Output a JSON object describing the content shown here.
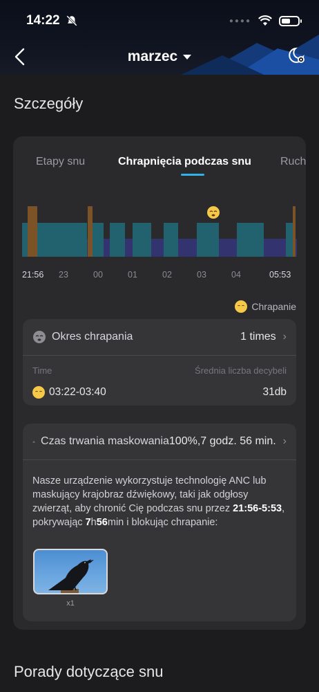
{
  "status": {
    "time": "14:22"
  },
  "nav": {
    "title": "marzec"
  },
  "sections": {
    "details": "Szczegóły",
    "tips": "Porady dotyczące snu"
  },
  "tabs": [
    {
      "label": "Etapy snu",
      "active": false
    },
    {
      "label": "Chrapnięcia podczas snu",
      "active": true
    },
    {
      "label": "Ruch",
      "active": false
    }
  ],
  "chart_data": {
    "type": "timeline",
    "x_tick_labels": [
      "21:56",
      "23",
      "00",
      "01",
      "02",
      "03",
      "04",
      "05:53"
    ],
    "legend": "Chrapanie",
    "colors": {
      "light": "#22616e",
      "deep": "#33336f",
      "awake": "#7b5327",
      "accent": "#2fb3e8"
    }
  },
  "snoring": {
    "title": "Okres chrapania",
    "count": "1 times",
    "col_time": "Time",
    "col_db": "Średnia liczba decybeli",
    "range": "03:22-03:40",
    "db": "31db"
  },
  "masking": {
    "title": "Czas trwania maskowania",
    "value": "100%,7 godz. 56 min.",
    "desc_part1": "Nasze urządzenie wykorzystuje technologię ANC lub maskujący krajobraz dźwiękowy, taki jak odgłosy zwierząt, aby chronić Cię podczas snu przez ",
    "desc_range": "21:56-5:53",
    "desc_part2": ", pokrywając ",
    "desc_h": "7",
    "desc_h_unit": "h",
    "desc_m": "56",
    "desc_part3": "min i blokując chrapanie:",
    "thumb_caption": "x1"
  }
}
